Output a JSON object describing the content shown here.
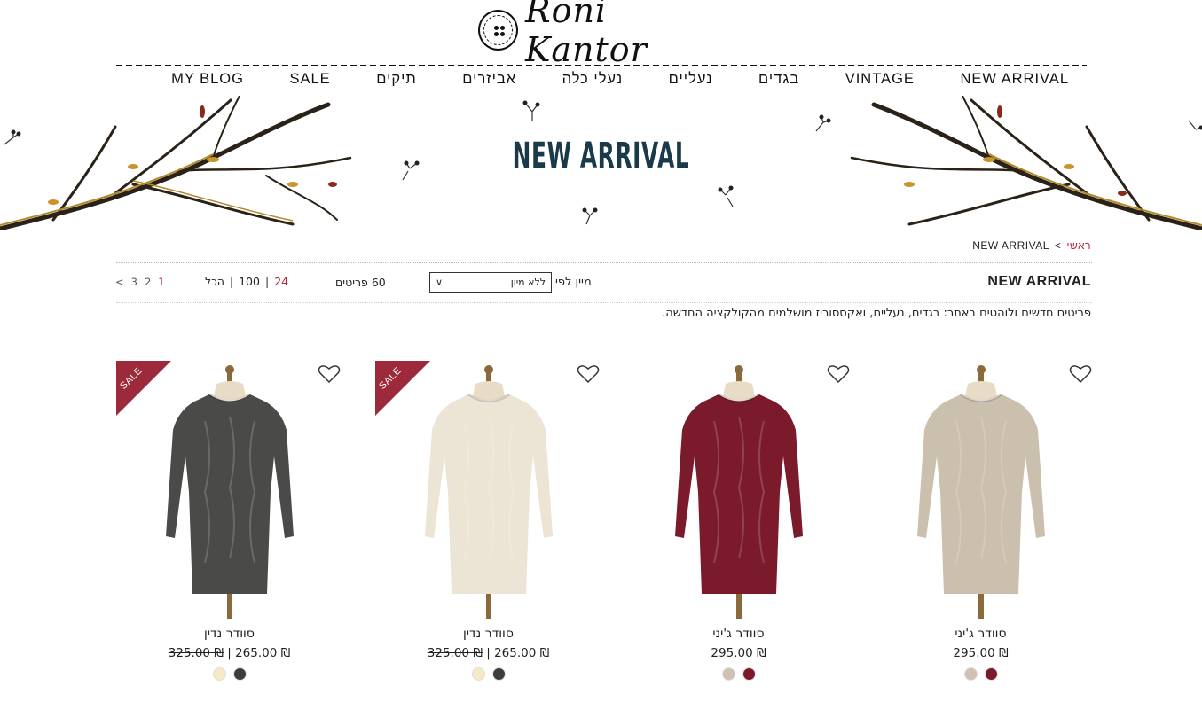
{
  "brand": {
    "logo_text": "Roni Kantor"
  },
  "nav": {
    "items": [
      {
        "label": "NEW ARRIVAL"
      },
      {
        "label": "VINTAGE"
      },
      {
        "label": "בגדים"
      },
      {
        "label": "נעליים"
      },
      {
        "label": "נעלי כלה"
      },
      {
        "label": "אביזרים"
      },
      {
        "label": "תיקים"
      },
      {
        "label": "SALE"
      },
      {
        "label": "MY BLOG"
      }
    ]
  },
  "banner": {
    "title": "NEW ARRIVAL"
  },
  "breadcrumb": {
    "home": "ראשי",
    "separator": ">",
    "current": "NEW ARRIVAL"
  },
  "toolbar": {
    "category_title": "NEW ARRIVAL",
    "sort_label": "מיין לפי",
    "sort_value": "ללא מיון",
    "items_count": "60 פריטים",
    "per_page": [
      "24",
      "100",
      "הכל"
    ],
    "pages": [
      "1",
      "2",
      "3"
    ]
  },
  "description": "פריטים חדשים ולוהטים באתר: בגדים, נעליים, ואקססוריז מושלמים מהקולקציה החדשה.",
  "products": [
    {
      "name": "סוודר נדין",
      "price": "₪ 265.00",
      "old_price": "₪ 325.00",
      "sale_label": "SALE",
      "color": "#4a4a48",
      "swatches": [
        "#f7e9c4",
        "#3d3d3d"
      ]
    },
    {
      "name": "סוודר נדין",
      "price": "₪ 265.00",
      "old_price": "₪ 325.00",
      "sale_label": "SALE",
      "color": "#ece4d4",
      "swatches": [
        "#f7e9c4",
        "#3d3d3d"
      ]
    },
    {
      "name": "סוודר ג'יני",
      "price": "₪ 295.00",
      "color": "#7a1a2a",
      "swatches": [
        "#cfc2b3",
        "#7a1a2a"
      ]
    },
    {
      "name": "סוודר ג'יני",
      "price": "₪ 295.00",
      "color": "#cbbfae",
      "swatches": [
        "#cfc2b3",
        "#7a1a2a"
      ]
    }
  ]
}
